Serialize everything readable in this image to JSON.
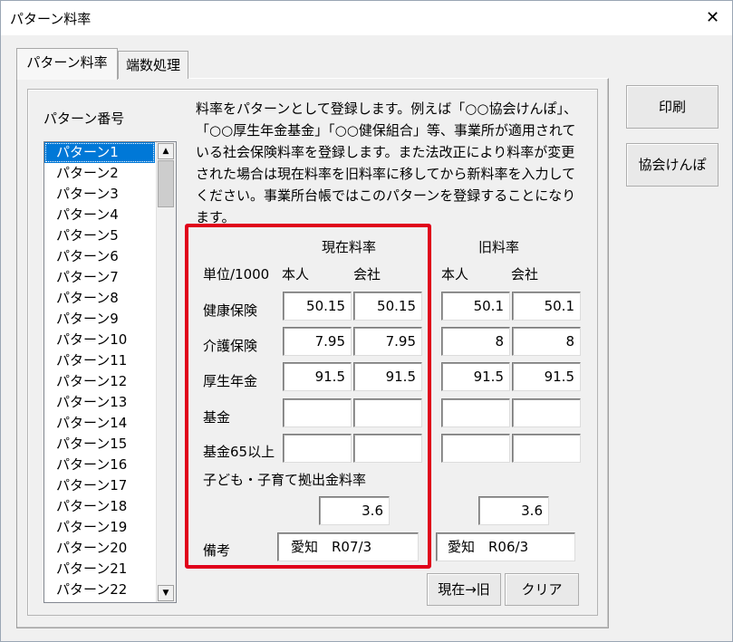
{
  "window": {
    "title": "パターン料率",
    "close_glyph": "✕"
  },
  "tabs": [
    {
      "label": "パターン料率",
      "active": true
    },
    {
      "label": "端数処理",
      "active": false
    }
  ],
  "pattern_list": {
    "label": "パターン番号",
    "items": [
      "パターン1",
      "パターン2",
      "パターン3",
      "パターン4",
      "パターン5",
      "パターン6",
      "パターン7",
      "パターン8",
      "パターン9",
      "パターン10",
      "パターン11",
      "パターン12",
      "パターン13",
      "パターン14",
      "パターン15",
      "パターン16",
      "パターン17",
      "パターン18",
      "パターン19",
      "パターン20",
      "パターン21",
      "パターン22"
    ],
    "selected": "パターン1"
  },
  "description": "料率をパターンとして登録します。例えば「○○協会けんぽ」、「○○厚生年金基金」「○○健保組合」等、事業所が適用されている社会保険料率を登録します。また法改正により料率が変更された場合は現在料率を旧料率に移してから新料率を入力してください。事業所台帳ではこのパターンを登録することになります。",
  "rates": {
    "unit_label": "単位/1000",
    "current_header": "現在料率",
    "old_header": "旧料率",
    "col_person": "本人",
    "col_company": "会社",
    "rows": [
      {
        "label": "健康保険",
        "cur_person": "50.15",
        "cur_company": "50.15",
        "old_person": "50.1",
        "old_company": "50.1"
      },
      {
        "label": "介護保険",
        "cur_person": "7.95",
        "cur_company": "7.95",
        "old_person": "8",
        "old_company": "8"
      },
      {
        "label": "厚生年金",
        "cur_person": "91.5",
        "cur_company": "91.5",
        "old_person": "91.5",
        "old_company": "91.5"
      },
      {
        "label": "基金",
        "cur_person": "",
        "cur_company": "",
        "old_person": "",
        "old_company": ""
      },
      {
        "label": "基金65以上",
        "cur_person": "",
        "cur_company": "",
        "old_person": "",
        "old_company": ""
      }
    ],
    "child_label": "子ども・子育て拠出金料率",
    "child_current": "3.6",
    "child_old": "3.6",
    "notes_label": "備考",
    "notes_current": "愛知　R07/3",
    "notes_old": "愛知　R06/3"
  },
  "buttons": {
    "print": "印刷",
    "kyokai": "協会けんぽ",
    "move": "現在→旧",
    "clear": "クリア"
  },
  "colors": {
    "selection": "#0078d7",
    "highlight_border": "#e0001b"
  }
}
